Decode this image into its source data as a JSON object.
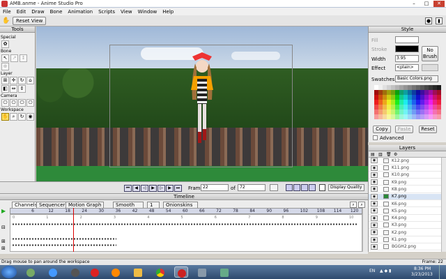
{
  "window": {
    "title": "AMB.anme - Anime Studio Pro"
  },
  "menu": [
    "File",
    "Edit",
    "Draw",
    "Bone",
    "Animation",
    "Scripts",
    "View",
    "Window",
    "Help"
  ],
  "toolbar": {
    "reset_view": "Reset View"
  },
  "tools": {
    "title": "Tools",
    "sections": [
      "Special",
      "Bone",
      "Layer",
      "Camera",
      "Workspace"
    ]
  },
  "style": {
    "title": "Style",
    "fill_label": "Fill",
    "stroke_label": "Stroke",
    "width_label": "Width",
    "width_value": "3.95",
    "effect_label": "Effect",
    "effect_value": "<plain>",
    "no_brush": "No Brush",
    "swatches_label": "Swatches",
    "swatches_value": "Basic Colors.png",
    "copy": "Copy",
    "paste": "Paste",
    "reset": "Reset",
    "advanced": "Advanced"
  },
  "layers": {
    "title": "Layers",
    "items": [
      "K12.png",
      "K11.png",
      "K10.png",
      "K9.png",
      "K8.png",
      "K7.png",
      "K6.png",
      "K5.png",
      "K4.png",
      "K3.png",
      "K2.png",
      "K1.png",
      "BGGH2.png"
    ],
    "selected_index": 5
  },
  "playback": {
    "frame_label": "Frame",
    "frame_value": "22",
    "of_label": "of",
    "total_frames": "72",
    "quality": "Display Quality"
  },
  "timeline": {
    "title": "Timeline",
    "tabs": [
      "Channels",
      "Sequencer",
      "Motion Graph"
    ],
    "interp": "Smooth",
    "interp_count": "1",
    "onionskins": "Onionskins",
    "ruler": [
      "6",
      "12",
      "18",
      "24",
      "30",
      "36",
      "42",
      "48",
      "54",
      "60",
      "66",
      "72",
      "78",
      "84",
      "90",
      "96",
      "102",
      "108",
      "114",
      "120"
    ],
    "sub_ruler": [
      "0",
      "1",
      "2",
      "3",
      "4",
      "5",
      "6",
      "7",
      "8",
      "9",
      "10"
    ]
  },
  "status": {
    "left": "Drag mouse to pan around the workspace",
    "right": "Frame: 22"
  },
  "taskbar": {
    "lang": "EN",
    "time": "8:36 PM",
    "date": "3/23/2013"
  }
}
